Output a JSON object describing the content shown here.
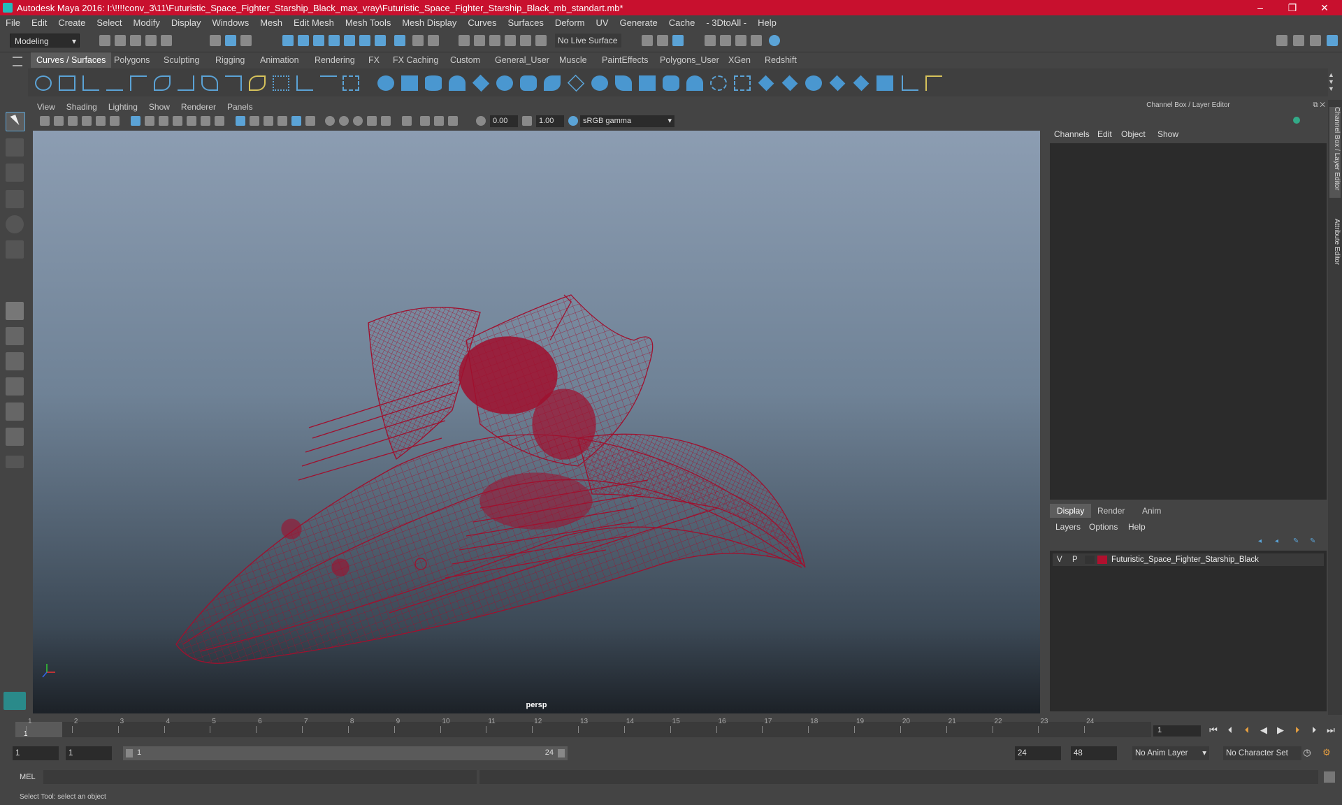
{
  "window": {
    "title": "Autodesk Maya 2016: I:\\!!!!conv_3\\11\\Futuristic_Space_Fighter_Starship_Black_max_vray\\Futuristic_Space_Fighter_Starship_Black_mb_standart.mb*",
    "minimize": "–",
    "maximize": "❐",
    "close": "✕"
  },
  "menubar": [
    "File",
    "Edit",
    "Create",
    "Select",
    "Modify",
    "Display",
    "Windows",
    "Mesh",
    "Edit Mesh",
    "Mesh Tools",
    "Mesh Display",
    "Curves",
    "Surfaces",
    "Deform",
    "UV",
    "Generate",
    "Cache",
    "- 3DtoAll -",
    "Help"
  ],
  "status": {
    "mode": "Modeling",
    "live_surface": "No Live Surface"
  },
  "shelf_tabs": [
    "Curves / Surfaces",
    "Polygons",
    "Sculpting",
    "Rigging",
    "Animation",
    "Rendering",
    "FX",
    "FX Caching",
    "Custom",
    "General_User",
    "Muscle",
    "PaintEffects",
    "Polygons_User",
    "XGen",
    "Redshift"
  ],
  "viewport": {
    "menu": [
      "View",
      "Shading",
      "Lighting",
      "Show",
      "Renderer",
      "Panels"
    ],
    "exposure": "0.00",
    "gamma": "1.00",
    "colorspace": "sRGB gamma",
    "camera": "persp"
  },
  "right_panel": {
    "header": "Channel Box / Layer Editor",
    "cb_menu": [
      "Channels",
      "Edit",
      "Object",
      "Show"
    ],
    "layer_tabs": [
      "Display",
      "Render",
      "Anim"
    ],
    "layer_menu": [
      "Layers",
      "Options",
      "Help"
    ],
    "layer": {
      "v": "V",
      "p": "P",
      "name": "Futuristic_Space_Fighter_Starship_Black",
      "color": "#b0102e"
    },
    "side_tabs": [
      "Channel Box / Layer Editor",
      "Attribute Editor"
    ]
  },
  "timeline": {
    "ticks": [
      "1",
      "2",
      "3",
      "4",
      "5",
      "6",
      "7",
      "8",
      "9",
      "10",
      "11",
      "12",
      "13",
      "14",
      "15",
      "16",
      "17",
      "18",
      "19",
      "20",
      "21",
      "22",
      "23",
      "24"
    ],
    "current_frame": "1",
    "frame_field": "1"
  },
  "range": {
    "start": "1",
    "start2": "1",
    "range_start": "1",
    "range_end": "24",
    "end": "24",
    "end2": "48",
    "anim_layer": "No Anim Layer",
    "char_set": "No Character Set"
  },
  "cmd": {
    "label": "MEL"
  },
  "help": "Select Tool: select an object",
  "colors": {
    "titlebar": "#c8102e",
    "wire": "#a0102e",
    "accent": "#5ba3d6"
  }
}
